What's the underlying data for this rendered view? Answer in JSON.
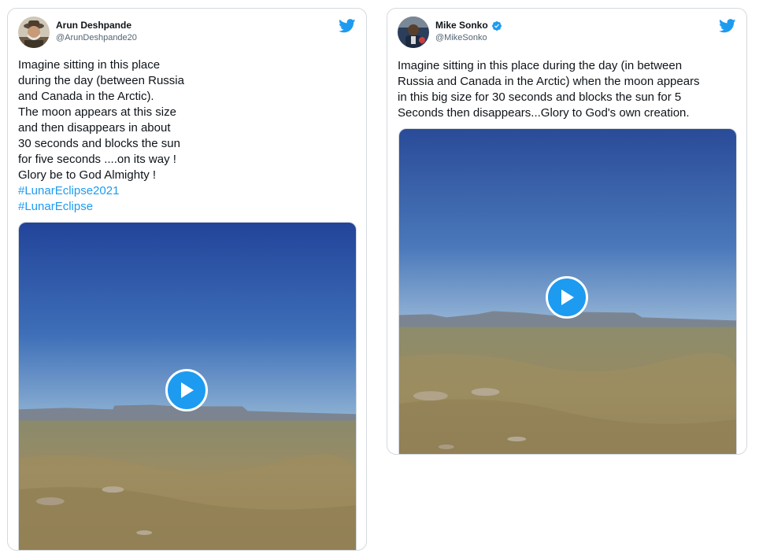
{
  "colors": {
    "brand": "#1d9bf0",
    "text": "#0f1419",
    "secondary": "#536471",
    "border": "#d4d9de"
  },
  "tweets": [
    {
      "author": {
        "name": "Arun Deshpande",
        "handle": "@ArunDeshpande20",
        "verified": false,
        "avatar_icon": "avatar-photo"
      },
      "text": "Imagine sitting in this place\nduring the day (between Russia\nand Canada in the Arctic).\nThe moon appears at this size\nand then disappears in about\n30 seconds and blocks the sun\nfor five seconds ....on its way !\nGlory be to God Almighty !",
      "hashtags": [
        "#LunarEclipse2021",
        "#LunarEclipse"
      ],
      "media": {
        "type": "video",
        "icon": "play-icon"
      },
      "logo_icon": "twitter-bird-icon"
    },
    {
      "author": {
        "name": "Mike Sonko",
        "handle": "@MikeSonko",
        "verified": true,
        "avatar_icon": "avatar-photo"
      },
      "text": "Imagine sitting in this place during the day (in between\nRussia and Canada in the Arctic) when the moon appears\nin this big size for 30 seconds and blocks the sun for 5\nSeconds then disappears...Glory to God's own creation.",
      "hashtags": [],
      "media": {
        "type": "video",
        "icon": "play-icon"
      },
      "logo_icon": "twitter-bird-icon"
    }
  ]
}
